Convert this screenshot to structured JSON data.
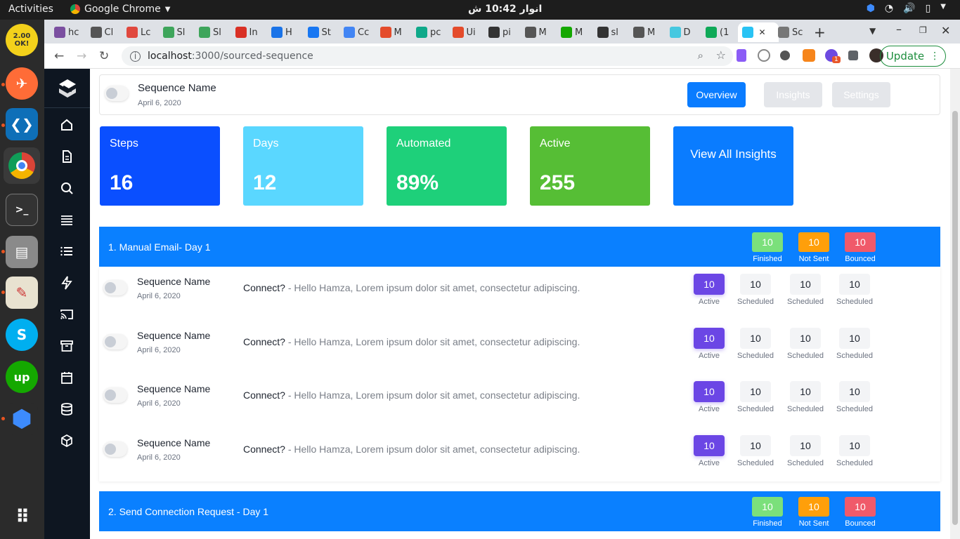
{
  "os": {
    "activities": "Activities",
    "app_name": "Google Chrome",
    "clock": "انوار 10:42 ش"
  },
  "dock": {
    "items": [
      "2.00 OK!",
      "Postman",
      "VS Code",
      "Chrome",
      "Terminal",
      "Files",
      "Text Editor",
      "Skype",
      "Upwork",
      "App",
      "Show Apps"
    ]
  },
  "browser": {
    "tabs": [
      "hc",
      "Cl",
      "Lc",
      "Sl",
      "Sl",
      "In",
      "H",
      "St",
      "Cc",
      "M",
      "pc",
      "Ui",
      "pi",
      "M",
      "M",
      "sl",
      "M",
      "D",
      "(1",
      "",
      "Sc"
    ],
    "url_host": "localhost",
    "url_path": ":3000/sourced-sequence",
    "update_label": "Update",
    "ext_badge": "1"
  },
  "header": {
    "sequence_name": "Sequence Name",
    "date": "April 6, 2020",
    "buttons": {
      "overview": "Overview",
      "insights": "Insights",
      "settings": "Settings"
    }
  },
  "stats": [
    {
      "label": "Steps",
      "value": "16",
      "color": "#0a4fff"
    },
    {
      "label": "Days",
      "value": "12",
      "color": "#5ad7ff"
    },
    {
      "label": "Automated",
      "value": "89%",
      "color": "#1ed07a"
    },
    {
      "label": "Active",
      "value": "255",
      "color": "#56be35"
    }
  ],
  "view_all": "View All Insights",
  "sections": [
    {
      "title": "1. Manual Email- Day 1",
      "summary": [
        {
          "value": "10",
          "label": "Finished",
          "color": "#7be07b"
        },
        {
          "value": "10",
          "label": "Not Sent",
          "color": "#ff9f0a"
        },
        {
          "value": "10",
          "label": "Bounced",
          "color": "#f05a6a"
        }
      ]
    },
    {
      "title": "2. Send Connection Request - Day 1",
      "summary": [
        {
          "value": "10",
          "label": "Finished",
          "color": "#7be07b"
        },
        {
          "value": "10",
          "label": "Not Sent",
          "color": "#ff9f0a"
        },
        {
          "value": "10",
          "label": "Bounced",
          "color": "#f05a6a"
        }
      ]
    }
  ],
  "rows": [
    {
      "name": "Sequence Name",
      "date": "April 6, 2020",
      "subject": "Connect?",
      "body": " - Hello Hamza, Lorem ipsum dolor sit amet, consectetur adipiscing.",
      "counts": [
        {
          "value": "10",
          "label": "Active"
        },
        {
          "value": "10",
          "label": "Scheduled"
        },
        {
          "value": "10",
          "label": "Scheduled"
        },
        {
          "value": "10",
          "label": "Scheduled"
        }
      ]
    },
    {
      "name": "Sequence Name",
      "date": "April 6, 2020",
      "subject": "Connect?",
      "body": " - Hello Hamza, Lorem ipsum dolor sit amet, consectetur adipiscing.",
      "counts": [
        {
          "value": "10",
          "label": "Active"
        },
        {
          "value": "10",
          "label": "Scheduled"
        },
        {
          "value": "10",
          "label": "Scheduled"
        },
        {
          "value": "10",
          "label": "Scheduled"
        }
      ]
    },
    {
      "name": "Sequence Name",
      "date": "April 6, 2020",
      "subject": "Connect?",
      "body": " - Hello Hamza, Lorem ipsum dolor sit amet, consectetur adipiscing.",
      "counts": [
        {
          "value": "10",
          "label": "Active"
        },
        {
          "value": "10",
          "label": "Scheduled"
        },
        {
          "value": "10",
          "label": "Scheduled"
        },
        {
          "value": "10",
          "label": "Scheduled"
        }
      ]
    },
    {
      "name": "Sequence Name",
      "date": "April 6, 2020",
      "subject": "Connect?",
      "body": " - Hello Hamza, Lorem ipsum dolor sit amet, consectetur adipiscing.",
      "counts": [
        {
          "value": "10",
          "label": "Active"
        },
        {
          "value": "10",
          "label": "Scheduled"
        },
        {
          "value": "10",
          "label": "Scheduled"
        },
        {
          "value": "10",
          "label": "Scheduled"
        }
      ]
    }
  ]
}
